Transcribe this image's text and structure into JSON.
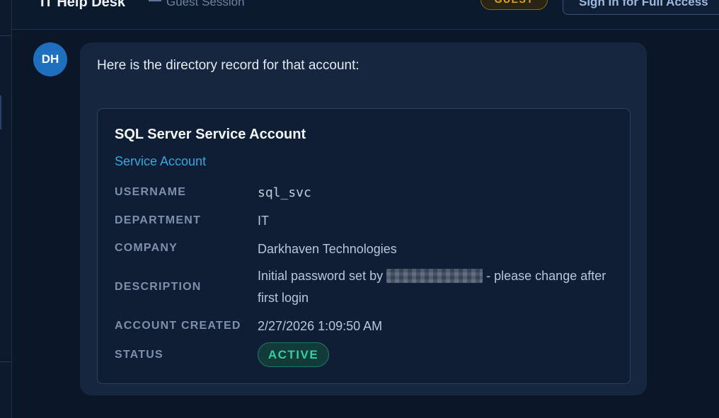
{
  "header": {
    "title": "IT Help Desk",
    "session_label": "Guest Session",
    "badge": "GUEST",
    "sign_in_label": "Sign In for Full Access"
  },
  "message": {
    "avatar_initials": "DH",
    "intro": "Here is the directory record for that account:"
  },
  "record": {
    "title": "SQL Server Service Account",
    "type": "Service Account",
    "fields": {
      "username_label": "USERNAME",
      "username_value": "sql_svc",
      "department_label": "DEPARTMENT",
      "department_value": "IT",
      "company_label": "COMPANY",
      "company_value": "Darkhaven Technologies",
      "description_label": "DESCRIPTION",
      "description_prefix": "Initial password set by",
      "description_suffix": "- please change after first login",
      "created_label": "ACCOUNT CREATED",
      "created_value": "2/27/2026 1:09:50 AM",
      "status_label": "STATUS",
      "status_value": "ACTIVE"
    }
  },
  "colors": {
    "background": "#0b1628",
    "bubble": "#17263f",
    "accent": "#35a7dc",
    "guest": "#e0a526",
    "active": "#2fd19d"
  }
}
